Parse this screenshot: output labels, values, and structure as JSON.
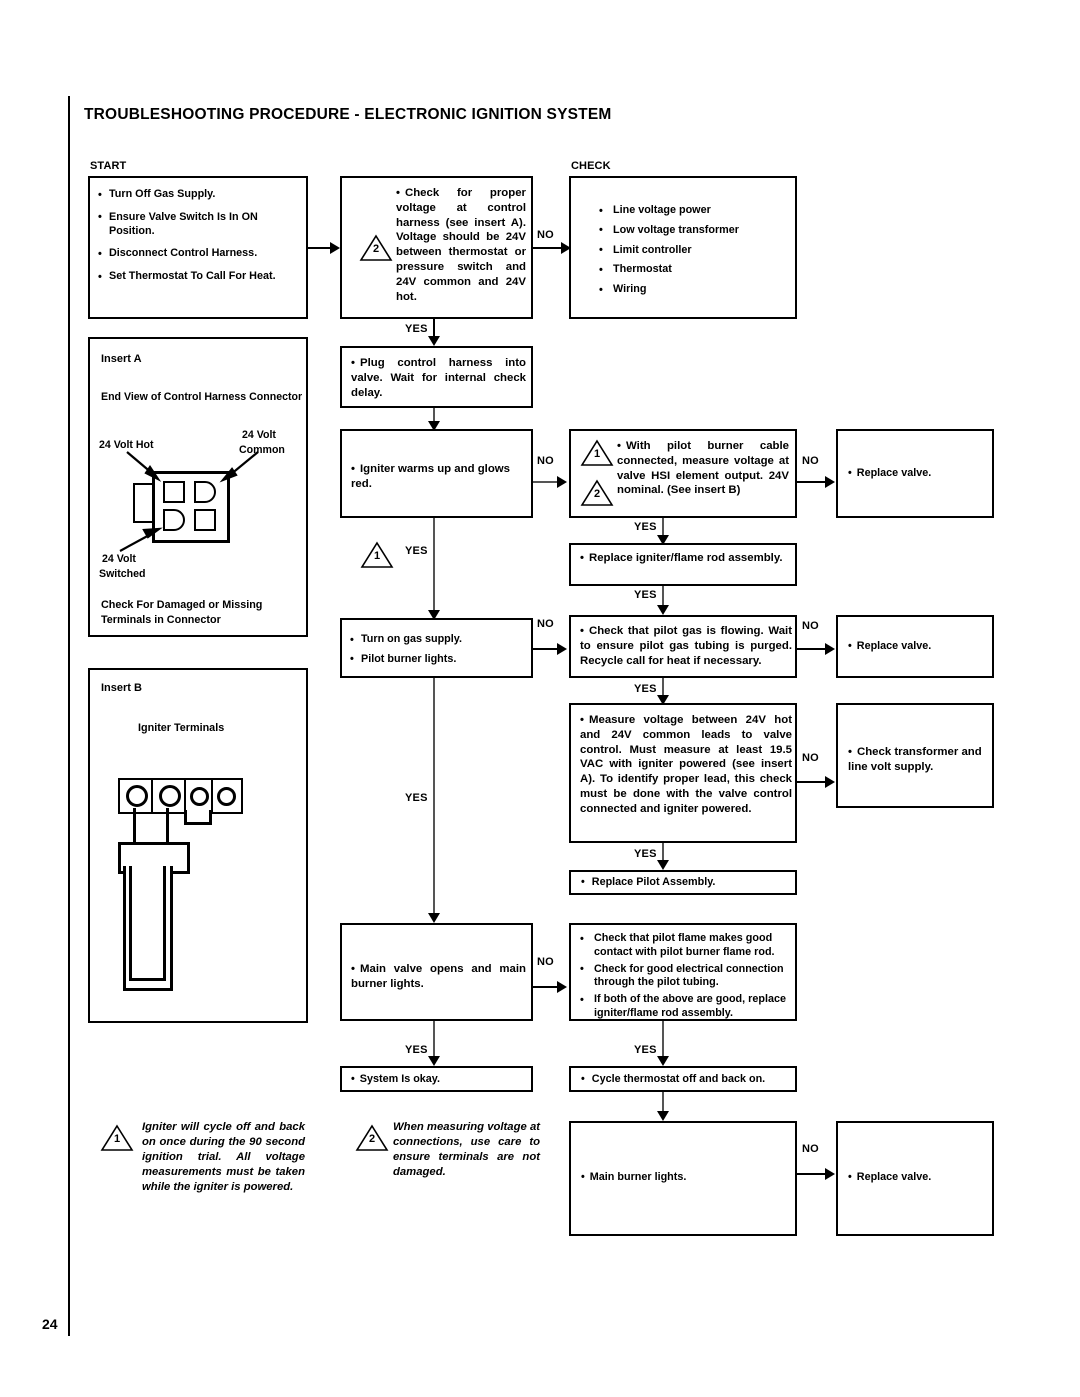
{
  "document": {
    "title": "TROUBLESHOOTING PROCEDURE - ELECTRONIC IGNITION SYSTEM",
    "page_number": "24"
  },
  "captions": {
    "start": "START",
    "check": "CHECK"
  },
  "boxes": {
    "start": {
      "items": [
        "Turn Off Gas Supply.",
        "Ensure Valve Switch Is In ON Position.",
        "Disconnect Control Harness.",
        "Set Thermostat To Call For Heat."
      ]
    },
    "check_voltage": {
      "note_ref": "2",
      "text": "Check for proper voltage at control harness (see insert A).  Voltage should be 24V between thermostat or pressure switch and 24V common and 24V hot."
    },
    "check_list": {
      "items": [
        "Line voltage power",
        "Low voltage transformer",
        "Limit controller",
        "Thermostat",
        "Wiring"
      ]
    },
    "plug_harness": {
      "text": "Plug control harness into valve. Wait for internal check delay."
    },
    "igniter_glows": {
      "text": "Igniter warms up and glows red."
    },
    "pilot_cable_voltage": {
      "note_ref_1": "1",
      "note_ref_2": "2",
      "text": "With pilot burner cable connected, measure voltage at valve HSI element output. 24V nominal.  (See insert B)"
    },
    "replace_valve_1": {
      "text": "Replace valve."
    },
    "replace_igniter": {
      "text": "Replace igniter/flame rod assembly."
    },
    "turn_on_gas": {
      "items": [
        "Turn on gas supply.",
        "Pilot burner lights."
      ]
    },
    "pilot_gas_flowing": {
      "text": "Check that pilot gas is flowing.  Wait to ensure pilot gas tubing is purged. Recycle call for heat if necessary."
    },
    "replace_valve_2": {
      "text": "Replace valve."
    },
    "measure_voltage": {
      "text": "Measure voltage between 24V hot and 24V common leads to valve control. Must measure at least 19.5 VAC with igniter powered (see insert A).  To identify proper lead, this check must be done with the valve control connected and igniter powered."
    },
    "check_transformer": {
      "text": "Check transformer and line volt supply."
    },
    "replace_pilot_assembly": {
      "text": "Replace Pilot Assembly."
    },
    "main_valve_opens": {
      "text": "Main valve opens and main burner lights."
    },
    "pilot_flame_checks": {
      "items": [
        "Check that pilot flame makes good contact with pilot burner flame rod.",
        "Check for good electrical connection through the pilot tubing.",
        "If both of the above are good, replace igniter/flame rod assembly."
      ]
    },
    "system_okay": {
      "text": "System Is okay."
    },
    "cycle_thermostat": {
      "text": "Cycle thermostat off and back on."
    },
    "main_burner_lights": {
      "text": "Main burner lights."
    },
    "replace_valve_3": {
      "text": "Replace valve."
    }
  },
  "insert_a": {
    "title": "Insert A",
    "subtitle": "End View of Control Harness Connector",
    "label_hot": "24 Volt Hot",
    "label_common": "24 Volt\nCommon",
    "label_common_l1": "24 Volt",
    "label_common_l2": "Common",
    "label_switched_l1": "24 Volt",
    "label_switched_l2": "Switched",
    "footer_l1": "Check For Damaged or Missing",
    "footer_l2": "Terminals in Connector"
  },
  "insert_b": {
    "title": "Insert B",
    "subtitle": "Igniter Terminals"
  },
  "edge_labels": {
    "no": "NO",
    "yes": "YES"
  },
  "footnotes": [
    {
      "ref": "1",
      "text": "Igniter will cycle off and back on once during the 90 second ignition trial.  All voltage measurements must be taken while the igniter is powered."
    },
    {
      "ref": "2",
      "text": "When measuring voltage at connections, use care to ensure terminals are not damaged."
    }
  ],
  "colors": {
    "ink": "#000000",
    "paper": "#ffffff",
    "connector_gray": "#555555"
  }
}
